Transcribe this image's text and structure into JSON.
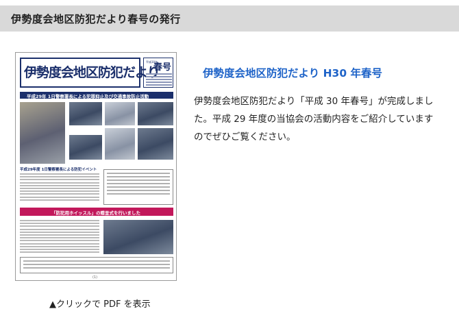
{
  "header": {
    "title": "伊勢度会地区防犯だより春号の発行"
  },
  "thumbnail": {
    "newsletter_title": "伊勢度会地区防犯だより",
    "issue_label": "春号",
    "issue_small": "平成30年",
    "banner1": "平成29年 1日警察署長による犯罪抑止及び交通事故防止活動",
    "subhead": "平成29年度 1日警察署長による防犯イベント",
    "banner2": "「防犯用ホイッスル」の贈呈式を行いました",
    "page_number": "(1)"
  },
  "article": {
    "title": "伊勢度会地区防犯だより H30 年春号",
    "body": "伊勢度会地区防犯だより「平成 30 年春号」が完成しました。平成 29 年度の当協会の活動内容をご紹介していますのでぜひご覧ください。"
  },
  "caption": "▲クリックで PDF を表示"
}
